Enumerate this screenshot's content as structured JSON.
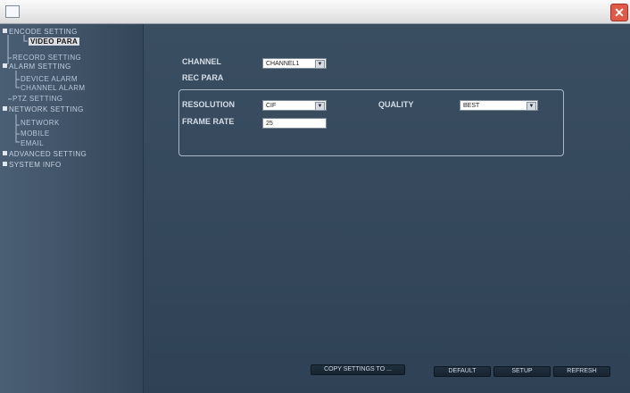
{
  "window": {
    "close_glyph": "✕"
  },
  "sidebar": {
    "items": [
      {
        "label": "ENCODE SETTING"
      },
      {
        "label": "VIDEO PARA"
      },
      {
        "label": "RECORD SETTING"
      },
      {
        "label": "ALARM SETTING"
      },
      {
        "label": "DEVICE ALARM"
      },
      {
        "label": "CHANNEL ALARM"
      },
      {
        "label": "PTZ SETTING"
      },
      {
        "label": "NETWORK SETTING"
      },
      {
        "label": "NETWORK"
      },
      {
        "label": "MOBILE"
      },
      {
        "label": "EMAIL"
      },
      {
        "label": "ADVANCED SETTING"
      },
      {
        "label": "SYSTEM INFO"
      }
    ]
  },
  "main": {
    "channel_label": "CHANNEL",
    "channel_value": "CHANNEL1",
    "rec_para_label": "REC PARA",
    "resolution_label": "RESOLUTION",
    "resolution_value": "CIF",
    "quality_label": "QUALITY",
    "quality_value": "BEST",
    "frame_rate_label": "FRAME RATE",
    "frame_rate_value": "25"
  },
  "buttons": {
    "copy": "COPY SETTINGS TO ...",
    "default": "DEFAULT",
    "setup": "SETUP",
    "refresh": "REFRESH"
  },
  "colors": {
    "background": "#34465a",
    "sidebar": "#3f5266",
    "selected_item_bg": "#d9dde3",
    "close_button": "#e05a48"
  }
}
